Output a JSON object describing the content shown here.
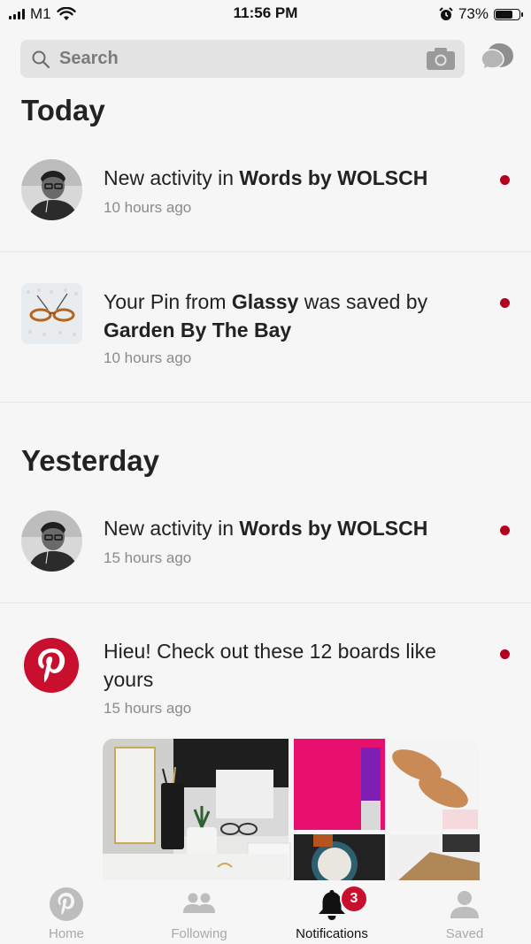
{
  "status_bar": {
    "carrier": "M1",
    "time": "11:56 PM",
    "battery_percent": "73%",
    "battery_level": 0.73,
    "icons": [
      "signal-icon",
      "wifi-icon",
      "alarm-icon",
      "battery-icon"
    ]
  },
  "search": {
    "placeholder": "Search",
    "icons": [
      "search-icon",
      "camera-icon",
      "messages-icon"
    ]
  },
  "sections": {
    "today": "Today",
    "yesterday": "Yesterday"
  },
  "notifications": [
    {
      "pre": "New activity in ",
      "bold1": "Words by WOLSCH",
      "mid": "",
      "bold2": "",
      "time": "10 hours ago",
      "unread": true
    },
    {
      "pre": "Your Pin from ",
      "bold1": "Glassy",
      "mid": " was saved by ",
      "bold2": "Garden By The Bay",
      "time": "10 hours ago",
      "unread": true
    },
    {
      "pre": "New activity in ",
      "bold1": "Words by WOLSCH",
      "mid": "",
      "bold2": "",
      "time": "15 hours ago",
      "unread": true
    },
    {
      "pre": "Hieu! Check out these 12 boards like yours",
      "bold1": "",
      "mid": "",
      "bold2": "",
      "time": "15 hours ago",
      "unread": true
    }
  ],
  "tabs": [
    {
      "label": "Home",
      "icon": "pinterest-logo-icon",
      "active": false
    },
    {
      "label": "Following",
      "icon": "people-icon",
      "active": false
    },
    {
      "label": "Notifications",
      "icon": "bell-icon",
      "active": true,
      "badge": "3"
    },
    {
      "label": "Saved",
      "icon": "person-icon",
      "active": false
    }
  ],
  "colors": {
    "accent": "#b3001e",
    "background": "#f5f6f5",
    "search_bg": "#e3e3e3"
  }
}
